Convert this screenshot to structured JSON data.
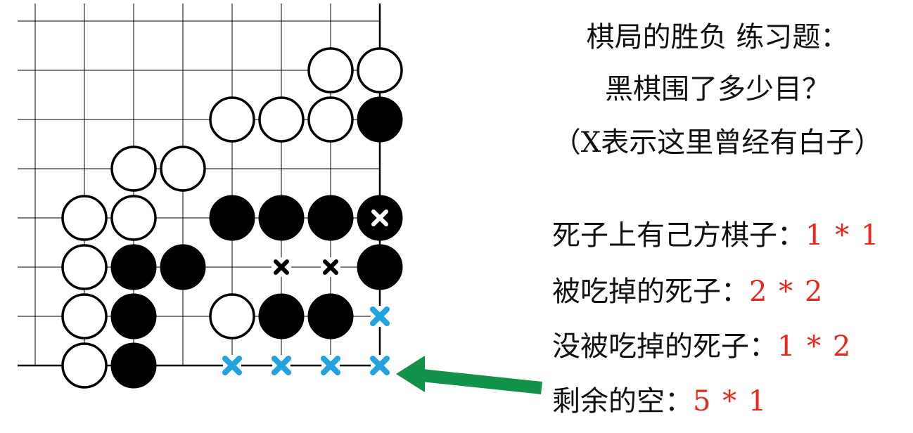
{
  "title": {
    "line1": "棋局的胜负 练习题：",
    "line2": "黑棋围了多少目？",
    "line3": "（X表示这里曾经有白子）"
  },
  "rows": [
    {
      "label": "死子上有己方棋子：",
      "value": "1 * 1"
    },
    {
      "label": "被吃掉的死子：",
      "value": "2 * 2"
    },
    {
      "label": "没被吃掉的死子：",
      "value": "1 * 2"
    },
    {
      "label": "剩余的空：",
      "value": "5 * 1"
    }
  ],
  "colors": {
    "value_text": "#e8271d",
    "blue_x": "#22a3df",
    "arrow": "#11914a",
    "black_stone": "#000000",
    "white_stone": "#ffffff"
  },
  "board": {
    "white_stones": [
      [
        6,
        1
      ],
      [
        7,
        1
      ],
      [
        4,
        2
      ],
      [
        5,
        2
      ],
      [
        6,
        2
      ],
      [
        2,
        3
      ],
      [
        3,
        3
      ],
      [
        1,
        4
      ],
      [
        1,
        5
      ],
      [
        1,
        6
      ],
      [
        1,
        7
      ],
      [
        2,
        4
      ],
      [
        4,
        6
      ]
    ],
    "black_stones": [
      [
        7,
        2
      ],
      [
        4,
        4
      ],
      [
        5,
        4
      ],
      [
        6,
        4
      ],
      [
        2,
        5
      ],
      [
        3,
        5
      ],
      [
        7,
        5
      ],
      [
        2,
        6
      ],
      [
        5,
        6
      ],
      [
        6,
        6
      ],
      [
        2,
        7
      ]
    ],
    "white_x_on_black": [
      [
        7,
        4
      ]
    ],
    "black_x_marks": [
      [
        5,
        5
      ],
      [
        6,
        5
      ]
    ],
    "blue_x_marks": [
      [
        7,
        6
      ],
      [
        4,
        7
      ],
      [
        5,
        7
      ],
      [
        6,
        7
      ],
      [
        7,
        7
      ]
    ]
  }
}
